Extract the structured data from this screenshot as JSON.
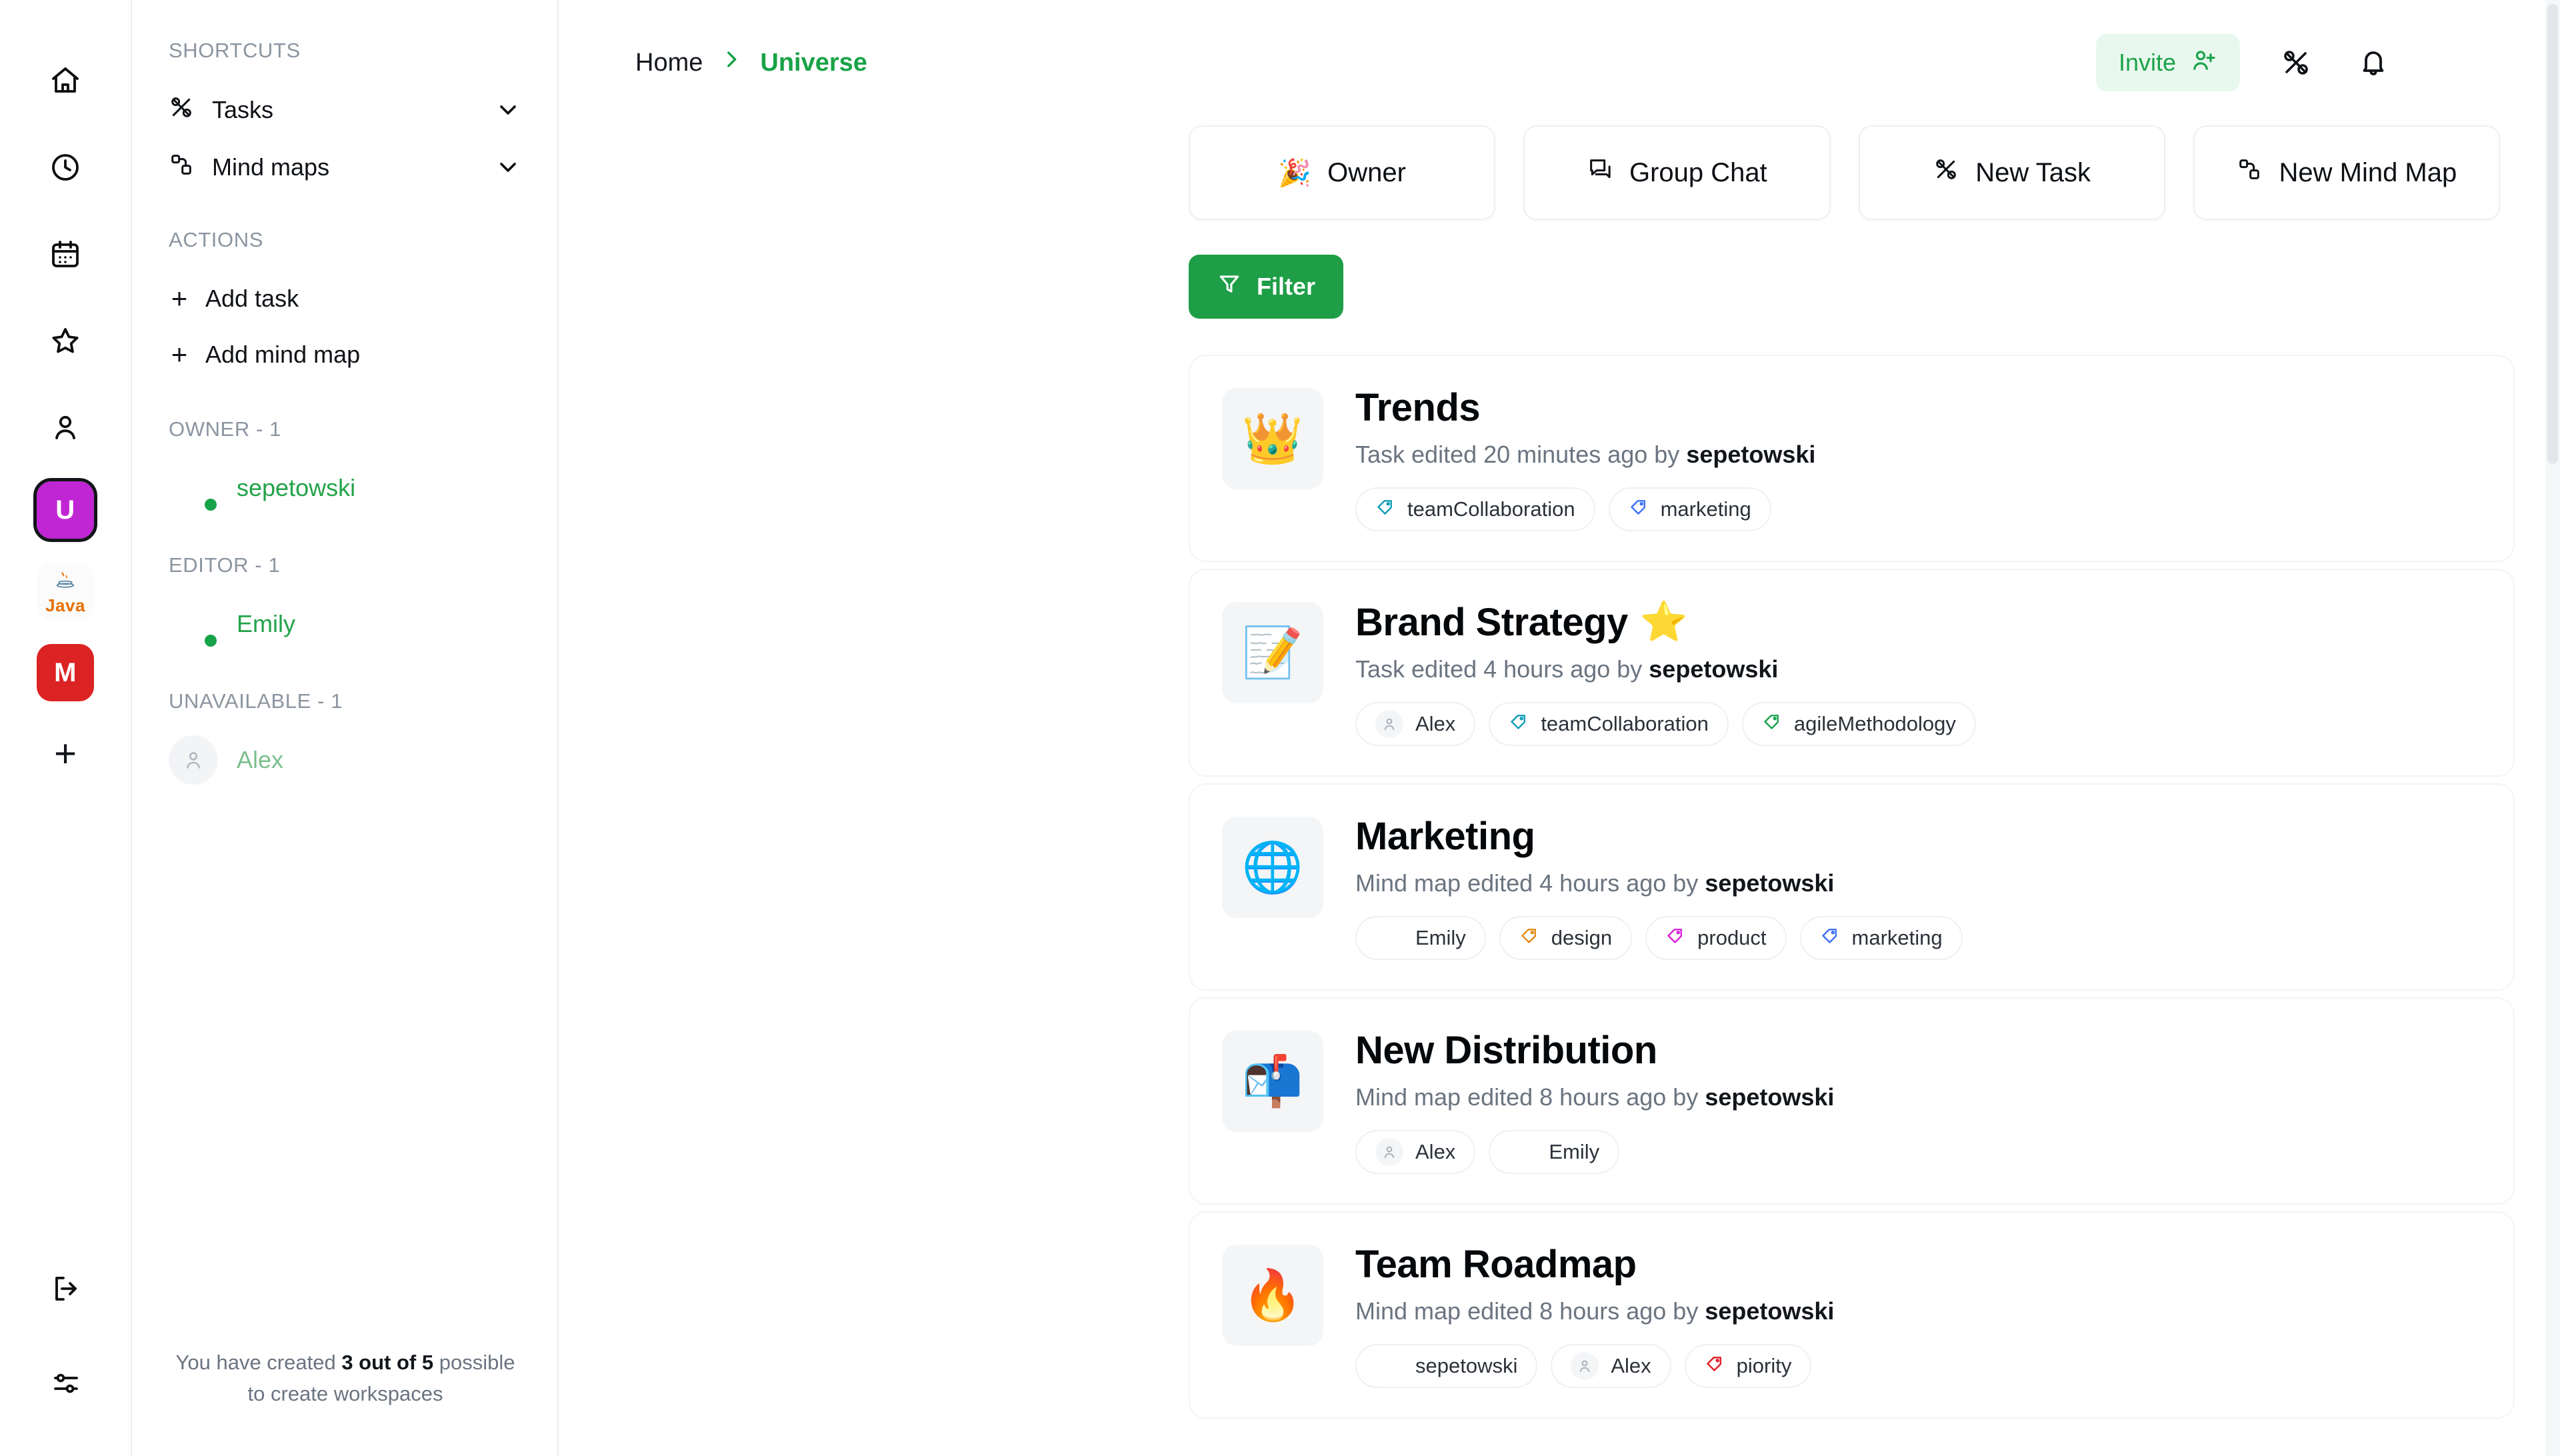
{
  "rail": {
    "icons": [
      {
        "name": "home-icon"
      },
      {
        "name": "history-clock-icon"
      },
      {
        "name": "calendar-icon"
      },
      {
        "name": "star-icon"
      },
      {
        "name": "person-icon"
      }
    ],
    "workspaces": [
      {
        "label": "U",
        "color": "#c026d3",
        "active": true
      },
      {
        "label": "Java",
        "color": "#fbfbfb",
        "active": false
      },
      {
        "label": "M",
        "color": "#dc2323",
        "active": false
      }
    ],
    "add_label": "+",
    "bottom": [
      {
        "name": "logout-icon"
      },
      {
        "name": "settings-sliders-icon"
      }
    ]
  },
  "nav": {
    "shortcuts_title": "SHORTCUTS",
    "shortcuts": [
      {
        "label": "Tasks",
        "icon": "tasks-icon"
      },
      {
        "label": "Mind maps",
        "icon": "mind-map-icon"
      }
    ],
    "actions_title": "ACTIONS",
    "actions": [
      {
        "label": "Add task"
      },
      {
        "label": "Add mind map"
      }
    ],
    "groups": [
      {
        "title": "OWNER - 1",
        "members": [
          {
            "name": "sepetowski",
            "online": true,
            "avatar": "photo-dark"
          }
        ]
      },
      {
        "title": "EDITOR - 1",
        "members": [
          {
            "name": "Emily",
            "online": true,
            "avatar": "photo-woman"
          }
        ]
      },
      {
        "title": "UNAVAILABLE - 1",
        "members": [
          {
            "name": "Alex",
            "online": false,
            "avatar": "placeholder"
          }
        ]
      }
    ],
    "workspace_note_pre": "You have created ",
    "workspace_note_strong": "3 out of 5",
    "workspace_note_post": " possible to create workspaces"
  },
  "header": {
    "breadcrumb_home": "Home",
    "breadcrumb_current": "Universe",
    "invite_label": "Invite",
    "accent_green": "#18a347",
    "invite_bg": "#e9f8ee"
  },
  "quick_actions": [
    {
      "label": "Owner",
      "icon": "owner-emoji"
    },
    {
      "label": "Group Chat",
      "icon": "group-chat-icon"
    },
    {
      "label": "New Task",
      "icon": "tasks-icon"
    },
    {
      "label": "New Mind Map",
      "icon": "mind-map-icon"
    }
  ],
  "filter": {
    "label": "Filter",
    "icon": "funnel-icon",
    "color": "#1e9e46"
  },
  "items": [
    {
      "emoji": "👑",
      "title": "Trends",
      "starred": false,
      "meta_pre": "Task edited 20 minutes ago by ",
      "meta_author": "sepetowski",
      "tags": [
        {
          "label": "teamCollaboration",
          "type": "tag",
          "color": "#0e9bb5"
        },
        {
          "label": "marketing",
          "type": "tag",
          "color": "#3b6ef5"
        }
      ]
    },
    {
      "emoji": "📝",
      "title": "Brand Strategy",
      "starred": true,
      "meta_pre": "Task edited 4 hours ago by ",
      "meta_author": "sepetowski",
      "tags": [
        {
          "label": "Alex",
          "type": "user-placeholder"
        },
        {
          "label": "teamCollaboration",
          "type": "tag",
          "color": "#0e9bb5"
        },
        {
          "label": "agileMethodology",
          "type": "tag",
          "color": "#17a34a"
        }
      ]
    },
    {
      "emoji": "🌐",
      "title": "Marketing",
      "starred": false,
      "meta_pre": "Mind map edited 4 hours ago by ",
      "meta_author": "sepetowski",
      "tags": [
        {
          "label": "Emily",
          "type": "user-photo-woman"
        },
        {
          "label": "design",
          "type": "tag",
          "color": "#e08a15"
        },
        {
          "label": "product",
          "type": "tag",
          "color": "#d61fd6"
        },
        {
          "label": "marketing",
          "type": "tag",
          "color": "#3b6ef5"
        }
      ]
    },
    {
      "emoji": "📬",
      "title": "New Distribution",
      "starred": false,
      "meta_pre": "Mind map edited 8 hours ago by ",
      "meta_author": "sepetowski",
      "tags": [
        {
          "label": "Alex",
          "type": "user-placeholder"
        },
        {
          "label": "Emily",
          "type": "user-photo-woman"
        }
      ]
    },
    {
      "emoji": "🔥",
      "title": "Team Roadmap",
      "starred": false,
      "meta_pre": "Mind map edited 8 hours ago by ",
      "meta_author": "sepetowski",
      "tags": [
        {
          "label": "sepetowski",
          "type": "user-photo-dark"
        },
        {
          "label": "Alex",
          "type": "user-placeholder"
        },
        {
          "label": "piority",
          "type": "tag",
          "color": "#e01b24"
        }
      ]
    }
  ]
}
